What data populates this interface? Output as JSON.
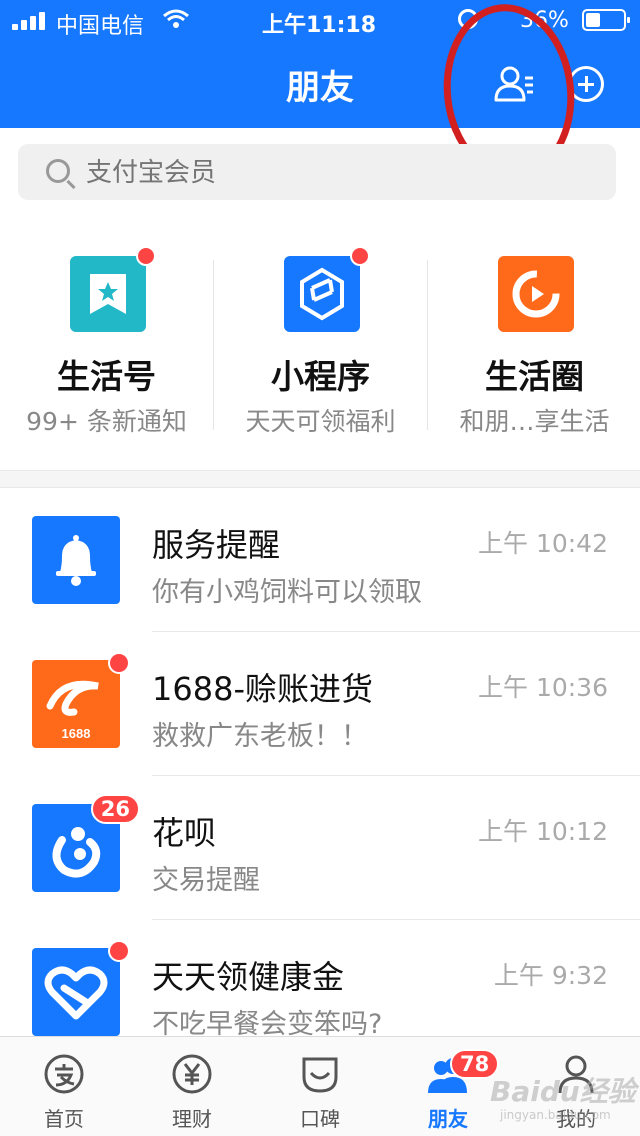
{
  "status_bar": {
    "carrier": "中国电信",
    "time": "上午11:18",
    "battery": "36%"
  },
  "header": {
    "title": "朋友"
  },
  "search": {
    "placeholder": "支付宝会员"
  },
  "features": [
    {
      "title": "生活号",
      "subtitle": "99+ 条新通知",
      "color": "#23b8c7",
      "icon": "bookmark-star-icon"
    },
    {
      "title": "小程序",
      "subtitle": "天天可领福利",
      "color": "#1677ff",
      "icon": "mini-program-icon"
    },
    {
      "title": "生活圈",
      "subtitle": "和朋…享生活",
      "color": "#ff6a1a",
      "icon": "life-circle-icon"
    }
  ],
  "messages": [
    {
      "title": "服务提醒",
      "subtitle": "你有小鸡饲料可以领取",
      "time": "上午 10:42",
      "color": "#1677ff",
      "icon": "bell-icon"
    },
    {
      "title": "1688-赊账进货",
      "subtitle": "救救广东老板！！",
      "time": "上午 10:36",
      "color": "#ff6a1a",
      "icon": "1688-logo-icon",
      "logo_text": "1688"
    },
    {
      "title": "花呗",
      "subtitle": "交易提醒",
      "time": "上午 10:12",
      "color": "#1677ff",
      "icon": "huabei-icon",
      "badge": "26"
    },
    {
      "title": "天天领健康金",
      "subtitle": "不吃早餐会变笨吗?",
      "time": "上午 9:32",
      "color": "#1677ff",
      "icon": "heart-icon"
    }
  ],
  "tabbar": [
    {
      "label": "首页",
      "icon": "home-alipay-icon"
    },
    {
      "label": "理财",
      "icon": "yuan-icon"
    },
    {
      "label": "口碑",
      "icon": "koubei-icon"
    },
    {
      "label": "朋友",
      "icon": "friends-icon",
      "badge": "78",
      "active": true
    },
    {
      "label": "我的",
      "icon": "person-icon"
    }
  ],
  "watermark": {
    "text": "Baidu经验",
    "sub": "jingyan.baidu.com"
  },
  "colors": {
    "brand": "#1677ff",
    "badge": "#ff4444",
    "annotation": "#d21f1f"
  }
}
